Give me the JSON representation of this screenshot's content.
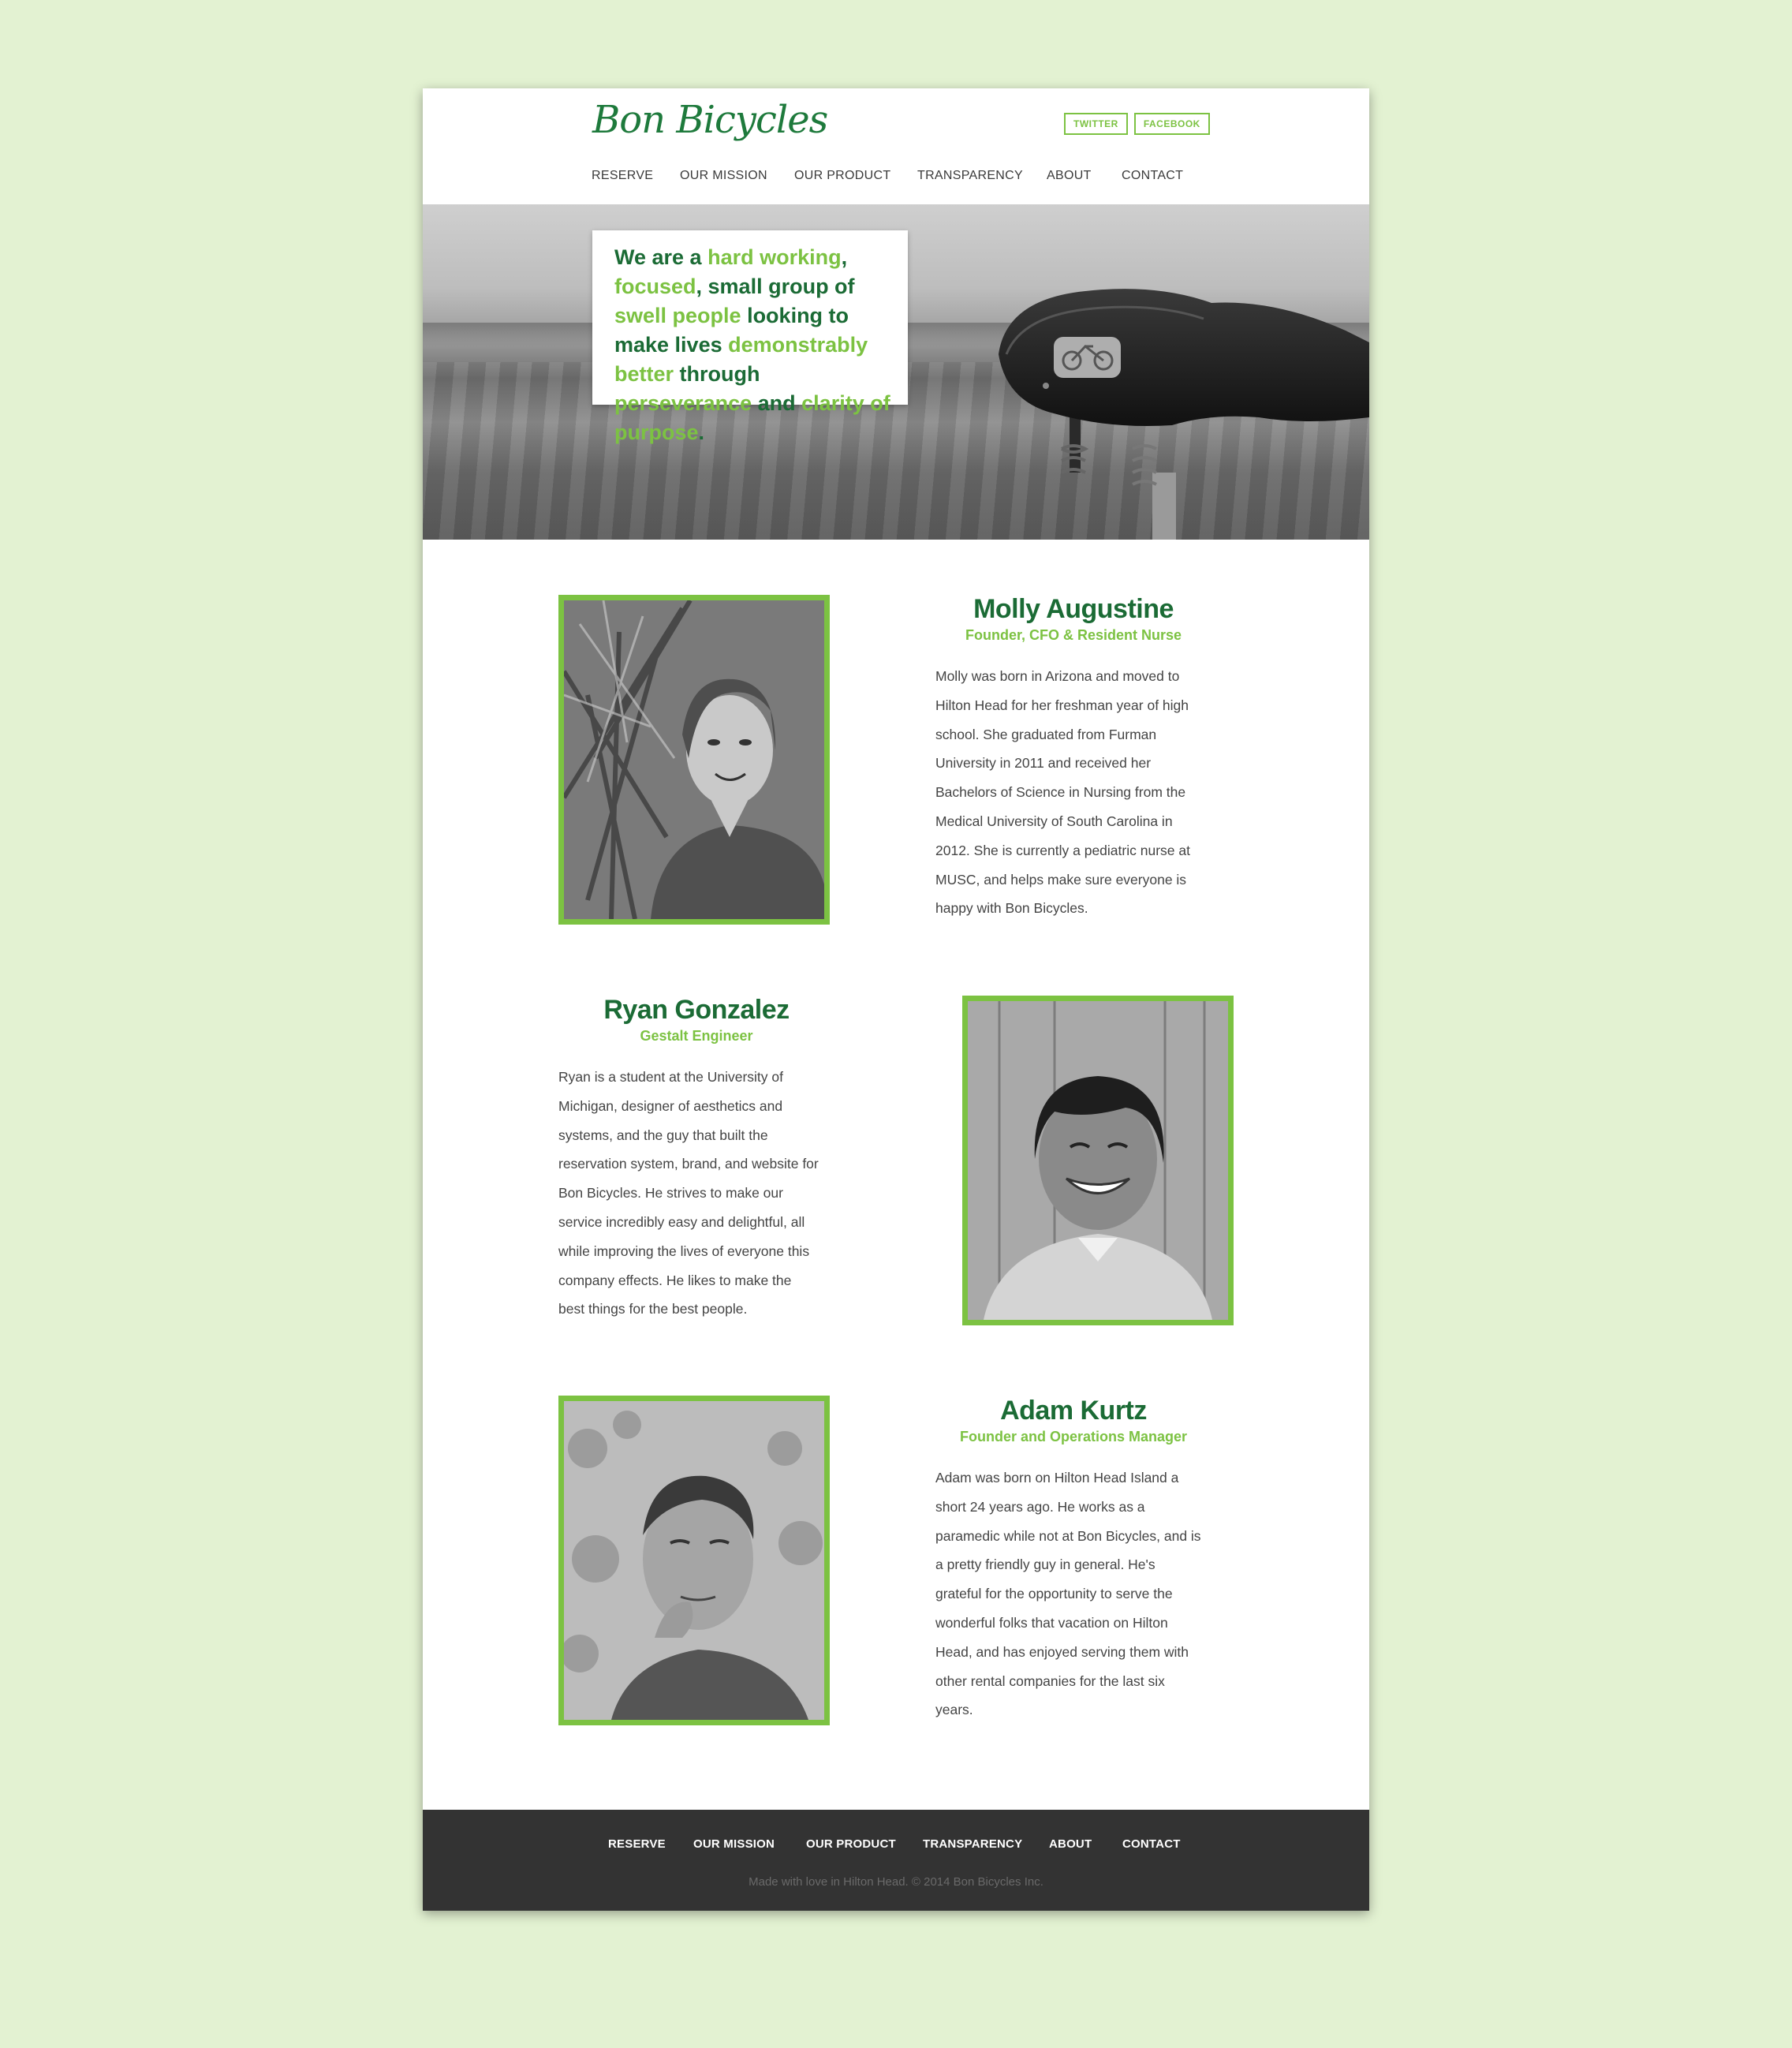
{
  "header": {
    "logo": "Bon Bicycles",
    "social": [
      "TWITTER",
      "FACEBOOK"
    ],
    "nav": [
      "RESERVE",
      "OUR MISSION",
      "OUR PRODUCT",
      "TRANSPARENCY",
      "ABOUT",
      "CONTACT"
    ]
  },
  "hero": {
    "mission": [
      {
        "t": "We are a ",
        "hl": false
      },
      {
        "t": "hard working",
        "hl": true
      },
      {
        "t": ", ",
        "hl": false
      },
      {
        "t": "focused",
        "hl": true
      },
      {
        "t": ", small group of ",
        "hl": false
      },
      {
        "t": "swell people",
        "hl": true
      },
      {
        "t": " looking to make lives ",
        "hl": false
      },
      {
        "t": "demonstrably better",
        "hl": true
      },
      {
        "t": " through ",
        "hl": false
      },
      {
        "t": "perseverance",
        "hl": true
      },
      {
        "t": " and ",
        "hl": false
      },
      {
        "t": "clarity of purpose",
        "hl": true
      },
      {
        "t": ".",
        "hl": false
      }
    ]
  },
  "team": [
    {
      "name": "Molly Augustine",
      "title": "Founder, CFO & Resident Nurse",
      "bio_lines": [
        "Molly was born in Arizona and moved to",
        "Hilton Head for her freshman year of high",
        "school. She graduated from Furman",
        "University in 2011 and received her",
        "Bachelors of Science in Nursing from the",
        "Medical University of South Carolina in",
        "2012. She is currently a pediatric nurse at",
        "MUSC, and helps make sure everyone is",
        "happy with Bon Bicycles."
      ]
    },
    {
      "name": "Ryan Gonzalez",
      "title": "Gestalt Engineer",
      "bio_lines": [
        "Ryan is a student at the University of",
        "Michigan, designer of aesthetics and",
        "systems, and the guy that built the",
        "reservation system, brand, and website for",
        "Bon Bicycles. He strives to make our",
        "service incredibly easy and delightful, all",
        "while improving the lives of everyone this",
        "company effects. He likes to make the",
        "best things for the best people."
      ]
    },
    {
      "name": "Adam Kurtz",
      "title": "Founder and Operations Manager",
      "bio_lines": [
        "Adam was born on Hilton Head Island a",
        "short 24 years ago. He works as a",
        "paramedic while not at Bon Bicycles, and is",
        "a pretty friendly guy in general. He's",
        "grateful for the opportunity to serve the",
        "wonderful folks that vacation on Hilton",
        "Head, and has enjoyed serving them with",
        "other rental companies for the last six",
        "years."
      ]
    }
  ],
  "footer": {
    "nav": [
      "RESERVE",
      "OUR MISSION",
      "OUR PRODUCT",
      "TRANSPARENCY",
      "ABOUT",
      "CONTACT"
    ],
    "copyright": "Made with love in Hilton Head. © 2014 Bon Bicycles Inc."
  },
  "colors": {
    "dark_green": "#1b6b35",
    "light_green": "#7cc242",
    "background": "#e3f2d2",
    "footer": "#333333"
  }
}
